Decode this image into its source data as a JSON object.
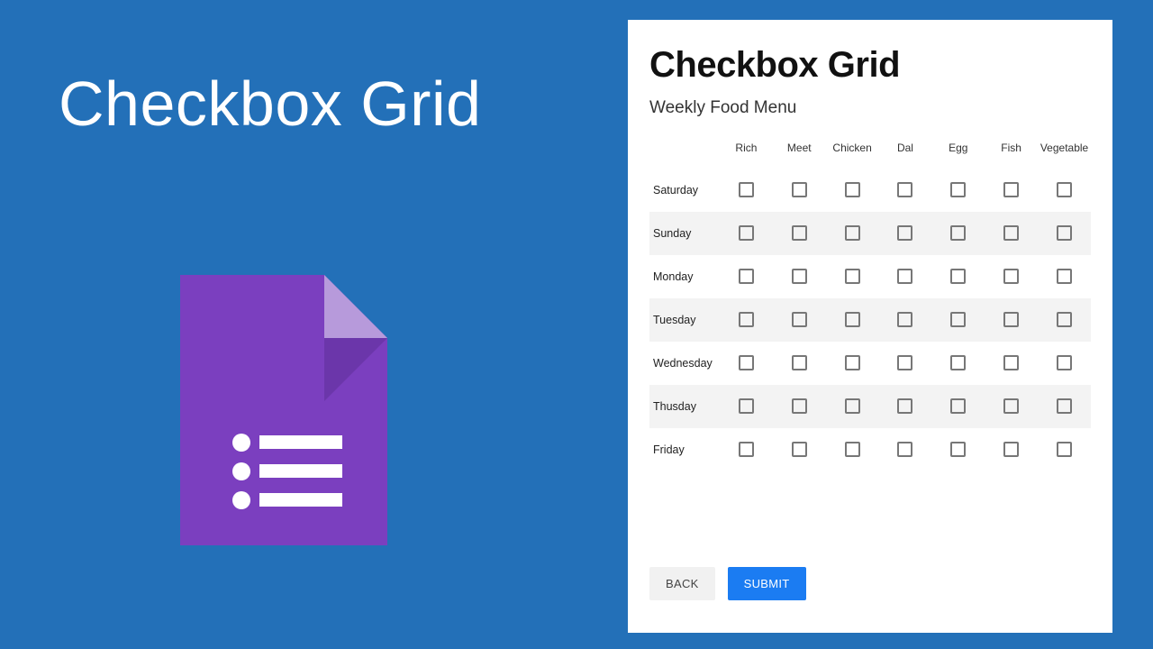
{
  "hero": {
    "title": "Checkbox Grid"
  },
  "icon": {
    "name": "google-forms-icon",
    "colors": {
      "main": "#7b3fbf",
      "fold_light": "#b79adb",
      "fold_dark": "#5f2f99",
      "accent": "#ffffff"
    }
  },
  "card": {
    "title": "Checkbox Grid",
    "subtitle": "Weekly Food Menu",
    "columns": [
      "Rich",
      "Meet",
      "Chicken",
      "Dal",
      "Egg",
      "Fish",
      "Vegetable"
    ],
    "rows": [
      "Saturday",
      "Sunday",
      "Monday",
      "Tuesday",
      "Wednesday",
      "Thusday",
      "Friday"
    ],
    "buttons": {
      "back": "BACK",
      "submit": "SUBMIT"
    },
    "colors": {
      "submit_bg": "#1b7cf2",
      "back_bg": "#f1f1f1"
    }
  }
}
